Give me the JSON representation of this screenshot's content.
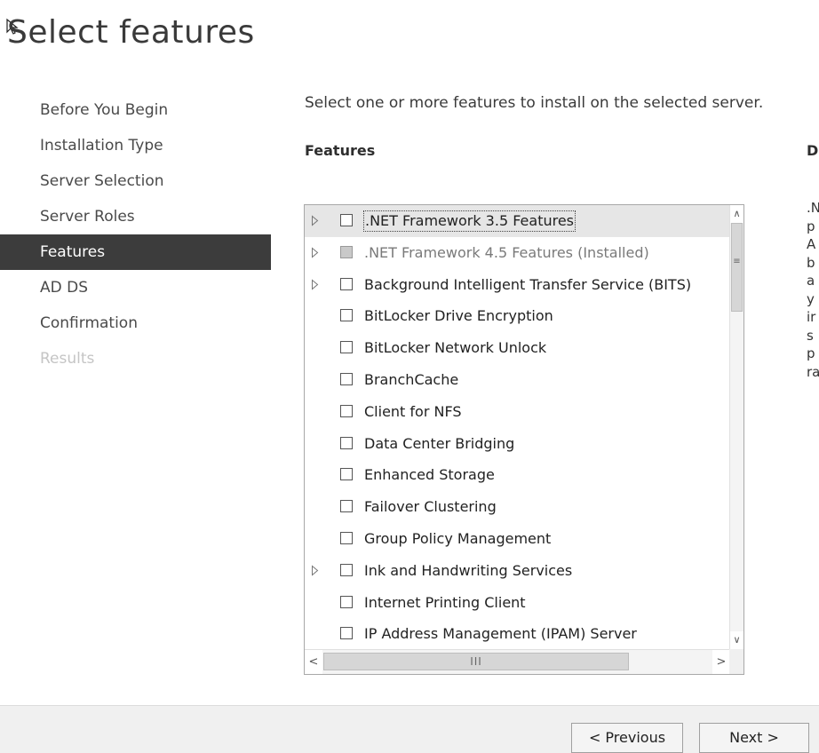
{
  "title": "Select features",
  "nav": {
    "items": [
      {
        "label": "Before You Begin",
        "state": "normal"
      },
      {
        "label": "Installation Type",
        "state": "normal"
      },
      {
        "label": "Server Selection",
        "state": "normal"
      },
      {
        "label": "Server Roles",
        "state": "normal"
      },
      {
        "label": "Features",
        "state": "active"
      },
      {
        "label": "AD DS",
        "state": "normal"
      },
      {
        "label": "Confirmation",
        "state": "normal"
      },
      {
        "label": "Results",
        "state": "disabled"
      }
    ]
  },
  "instruction": "Select one or more features to install on the selected server.",
  "features": {
    "heading": "Features",
    "items": [
      {
        "label": ".NET Framework 3.5 Features",
        "expandable": true,
        "checked": false,
        "installed": false,
        "selected": true
      },
      {
        "label": ".NET Framework 4.5 Features (Installed)",
        "expandable": true,
        "checked": true,
        "installed": true,
        "selected": false
      },
      {
        "label": "Background Intelligent Transfer Service (BITS)",
        "expandable": true,
        "checked": false,
        "installed": false,
        "selected": false
      },
      {
        "label": "BitLocker Drive Encryption",
        "expandable": false,
        "checked": false,
        "installed": false,
        "selected": false
      },
      {
        "label": "BitLocker Network Unlock",
        "expandable": false,
        "checked": false,
        "installed": false,
        "selected": false
      },
      {
        "label": "BranchCache",
        "expandable": false,
        "checked": false,
        "installed": false,
        "selected": false
      },
      {
        "label": "Client for NFS",
        "expandable": false,
        "checked": false,
        "installed": false,
        "selected": false
      },
      {
        "label": "Data Center Bridging",
        "expandable": false,
        "checked": false,
        "installed": false,
        "selected": false
      },
      {
        "label": "Enhanced Storage",
        "expandable": false,
        "checked": false,
        "installed": false,
        "selected": false
      },
      {
        "label": "Failover Clustering",
        "expandable": false,
        "checked": false,
        "installed": false,
        "selected": false
      },
      {
        "label": "Group Policy Management",
        "expandable": false,
        "checked": false,
        "installed": false,
        "selected": false
      },
      {
        "label": "Ink and Handwriting Services",
        "expandable": true,
        "checked": false,
        "installed": false,
        "selected": false
      },
      {
        "label": "Internet Printing Client",
        "expandable": false,
        "checked": false,
        "installed": false,
        "selected": false
      },
      {
        "label": "IP Address Management (IPAM) Server",
        "expandable": false,
        "checked": false,
        "installed": false,
        "selected": false
      },
      {
        "label": "",
        "expandable": false,
        "checked": false,
        "installed": false,
        "selected": false
      }
    ],
    "scroll": {
      "up_glyph": "∧",
      "down_glyph": "∨",
      "grip_glyph": "≡",
      "left_glyph": "<",
      "right_glyph": ">",
      "h_grip_glyph": "III"
    }
  },
  "description": {
    "heading": "D",
    "lines": [
      ".N",
      "p",
      "A",
      "b",
      "a",
      "y",
      "ir",
      "s",
      "p",
      "ra"
    ]
  },
  "buttons": {
    "previous": "< Previous",
    "next": "Next >"
  },
  "colors": {
    "active_nav_bg": "#3c3c3c",
    "selected_row_bg": "#e6e6e6",
    "footer_bg": "#f0f0f0"
  }
}
